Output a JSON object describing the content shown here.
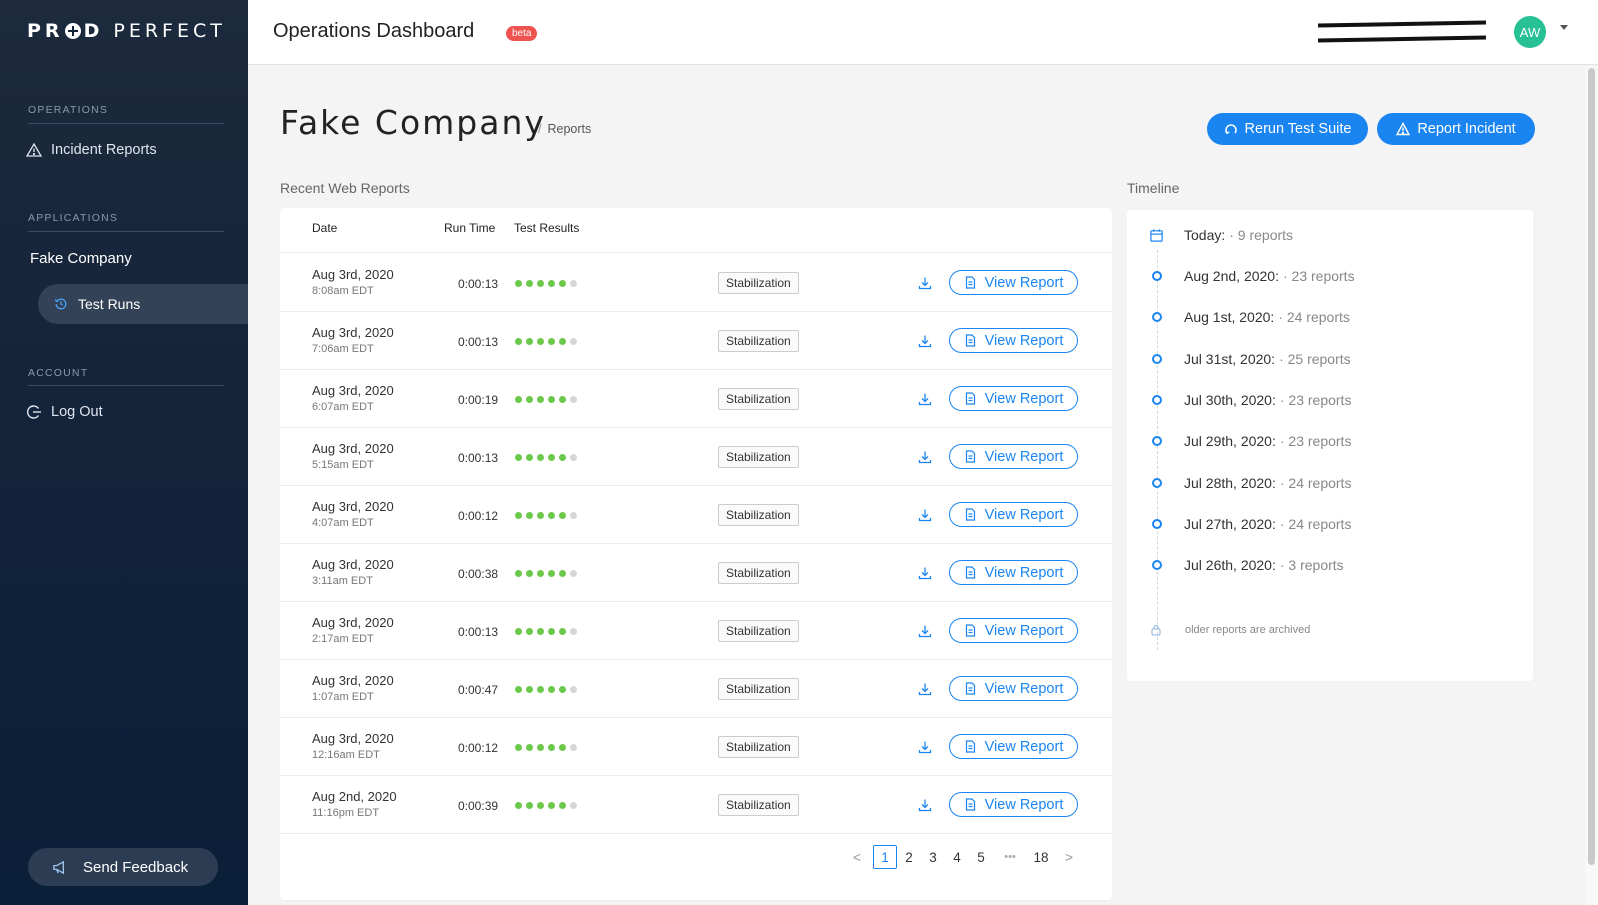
{
  "brand": {
    "logo_text_a": "PR",
    "logo_text_b": "D",
    "logo_text_c": "PERFECT"
  },
  "sidebar": {
    "operations_label": "OPERATIONS",
    "incident_reports": "Incident Reports",
    "applications_label": "APPLICATIONS",
    "app_name": "Fake Company",
    "test_runs": "Test Runs",
    "account_label": "ACCOUNT",
    "log_out": "Log Out",
    "send_feedback": "Send Feedback"
  },
  "topbar": {
    "title": "Operations Dashboard",
    "beta": "beta",
    "avatar_initials": "AW"
  },
  "header": {
    "company": "Fake Company",
    "breadcrumb_sep": "/",
    "breadcrumb": "Reports",
    "rerun_button": "Rerun Test Suite",
    "report_incident_button": "Report Incident"
  },
  "reports": {
    "heading": "Recent Web Reports",
    "columns": {
      "date": "Date",
      "run_time": "Run Time",
      "test_results": "Test Results"
    },
    "view_label": "View Report",
    "rows": [
      {
        "date": "Aug 3rd, 2020",
        "time": "8:08am EDT",
        "run_time": "0:00:13",
        "passed": 5,
        "total": 6,
        "tag": "Stabilization"
      },
      {
        "date": "Aug 3rd, 2020",
        "time": "7:06am EDT",
        "run_time": "0:00:13",
        "passed": 5,
        "total": 6,
        "tag": "Stabilization"
      },
      {
        "date": "Aug 3rd, 2020",
        "time": "6:07am EDT",
        "run_time": "0:00:19",
        "passed": 5,
        "total": 6,
        "tag": "Stabilization"
      },
      {
        "date": "Aug 3rd, 2020",
        "time": "5:15am EDT",
        "run_time": "0:00:13",
        "passed": 5,
        "total": 6,
        "tag": "Stabilization"
      },
      {
        "date": "Aug 3rd, 2020",
        "time": "4:07am EDT",
        "run_time": "0:00:12",
        "passed": 5,
        "total": 6,
        "tag": "Stabilization"
      },
      {
        "date": "Aug 3rd, 2020",
        "time": "3:11am EDT",
        "run_time": "0:00:38",
        "passed": 5,
        "total": 6,
        "tag": "Stabilization"
      },
      {
        "date": "Aug 3rd, 2020",
        "time": "2:17am EDT",
        "run_time": "0:00:13",
        "passed": 5,
        "total": 6,
        "tag": "Stabilization"
      },
      {
        "date": "Aug 3rd, 2020",
        "time": "1:07am EDT",
        "run_time": "0:00:47",
        "passed": 5,
        "total": 6,
        "tag": "Stabilization"
      },
      {
        "date": "Aug 3rd, 2020",
        "time": "12:16am EDT",
        "run_time": "0:00:12",
        "passed": 5,
        "total": 6,
        "tag": "Stabilization"
      },
      {
        "date": "Aug 2nd, 2020",
        "time": "11:16pm EDT",
        "run_time": "0:00:39",
        "passed": 5,
        "total": 6,
        "tag": "Stabilization"
      }
    ],
    "pagination": {
      "prev": "<",
      "pages": [
        "1",
        "2",
        "3",
        "4",
        "5"
      ],
      "ellipsis": "•••",
      "last": "18",
      "next": ">",
      "current": "1"
    }
  },
  "timeline": {
    "heading": "Timeline",
    "today_label": "Today:",
    "today_count": "· 9 reports",
    "items": [
      {
        "date": "Aug 2nd, 2020:",
        "count": "· 23 reports"
      },
      {
        "date": "Aug 1st, 2020:",
        "count": "· 24 reports"
      },
      {
        "date": "Jul 31st, 2020:",
        "count": "· 25 reports"
      },
      {
        "date": "Jul 30th, 2020:",
        "count": "· 23 reports"
      },
      {
        "date": "Jul 29th, 2020:",
        "count": "· 23 reports"
      },
      {
        "date": "Jul 28th, 2020:",
        "count": "· 24 reports"
      },
      {
        "date": "Jul 27th, 2020:",
        "count": "· 24 reports"
      },
      {
        "date": "Jul 26th, 2020:",
        "count": "· 3 reports"
      }
    ],
    "archived_note": "older reports are archived"
  },
  "colors": {
    "accent": "#1a85f0",
    "sidebar_bg": "#13233a",
    "pass": "#6cc84a",
    "beta": "#ef5350",
    "avatar": "#27c195"
  },
  "icons": {
    "incident": "warning-triangle-icon",
    "test_runs": "history-clock-icon",
    "logout": "logout-icon",
    "feedback": "megaphone-icon",
    "rerun": "rerun-icon",
    "report_incident": "warning-triangle-icon",
    "download": "download-icon",
    "view_report": "document-icon",
    "calendar": "calendar-icon",
    "lock": "lock-icon"
  }
}
